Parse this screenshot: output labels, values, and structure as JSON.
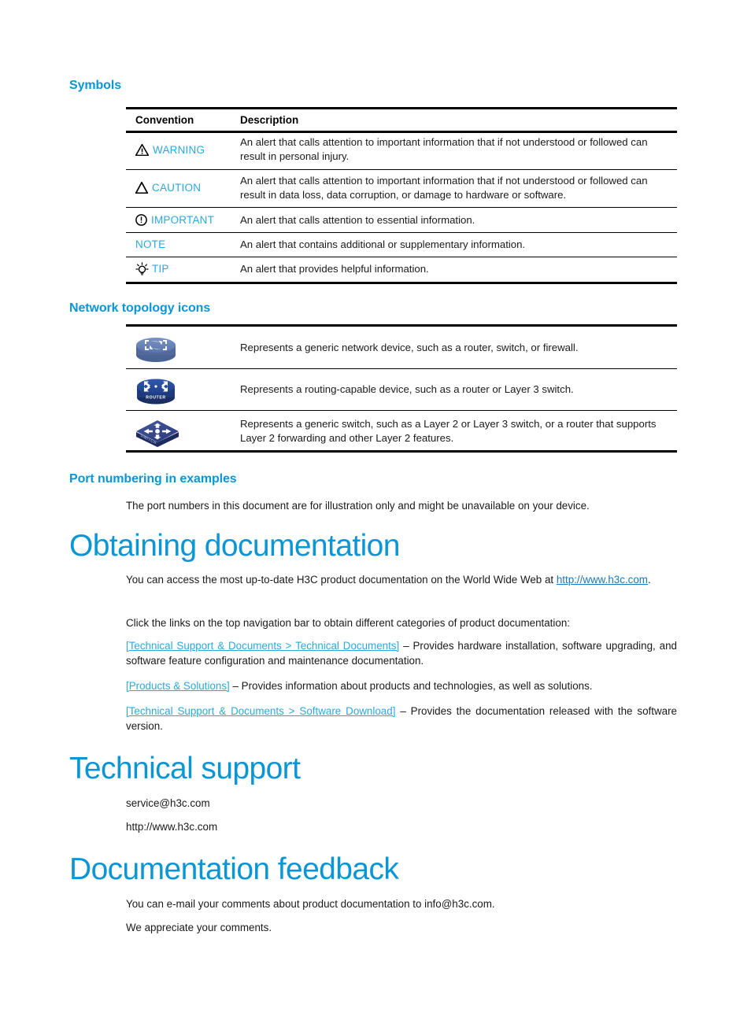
{
  "sections": {
    "symbols_heading": "Symbols",
    "topology_heading": "Network topology icons",
    "port_heading": "Port numbering in examples",
    "obtaining_heading": "Obtaining documentation",
    "support_heading": "Technical support",
    "feedback_heading": "Documentation feedback"
  },
  "symbols_table": {
    "headers": {
      "convention": "Convention",
      "description": "Description"
    },
    "rows": [
      {
        "icon": "warning-triangle-icon",
        "label": "WARNING",
        "description": "An alert that calls attention to important information that if not understood or followed can result in personal injury."
      },
      {
        "icon": "caution-triangle-icon",
        "label": "CAUTION",
        "description": "An alert that calls attention to important information that if not understood or followed can result in data loss, data corruption, or damage to hardware or software."
      },
      {
        "icon": "important-exclamation-circle-icon",
        "label": "IMPORTANT",
        "description": "An alert that calls attention to essential information."
      },
      {
        "icon": "",
        "label": "NOTE",
        "description": "An alert that contains additional or supplementary information."
      },
      {
        "icon": "tip-lightbulb-icon",
        "label": "TIP",
        "description": "An alert that provides helpful information."
      }
    ]
  },
  "topology_table": {
    "rows": [
      {
        "icon": "generic-network-device-icon",
        "icon_label": "",
        "description": "Represents a generic network device, such as a router, switch, or firewall."
      },
      {
        "icon": "router-icon",
        "icon_label": "ROUTER",
        "description": "Represents a routing-capable device, such as a router or Layer 3 switch."
      },
      {
        "icon": "switch-icon",
        "icon_label": "SWITCH",
        "description": "Represents a generic switch, such as a Layer 2 or Layer 3 switch, or a router that supports Layer 2 forwarding and other Layer 2 features."
      }
    ]
  },
  "port_numbering": {
    "text": "The port numbers in this document are for illustration only and might be unavailable on your device."
  },
  "obtaining": {
    "para1_before": "You can access the most up-to-date H3C product documentation on the World Wide Web at ",
    "para1_link": "http://www.h3c.com",
    "para1_after": ".",
    "para2": "Click the links on the top navigation bar to obtain different categories of product documentation:",
    "item1_link": "[Technical Support & Documents > Technical Documents]",
    "item1_text": " – Provides hardware installation, software upgrading, and software feature configuration and maintenance documentation.",
    "item2_link": "[Products & Solutions]",
    "item2_text": " – Provides information about products and technologies, as well as solutions.",
    "item3_link": "[Technical Support & Documents > Software Download]",
    "item3_text": " – Provides the documentation released with the software version."
  },
  "technical_support": {
    "email": "service@h3c.com",
    "website": "http://www.h3c.com"
  },
  "feedback": {
    "line1": "You can e-mail your comments about product documentation to info@h3c.com.",
    "line2": "We appreciate your comments."
  },
  "colors": {
    "heading_blue": "#0a96d4",
    "label_blue": "#2aa8e0",
    "link_blue": "#1878be",
    "rule_black": "#000000",
    "device_icon_blue": "#5b79b0",
    "router_icon_blue": "#2b4fa0",
    "switch_icon_blue": "#3b4f9e"
  }
}
